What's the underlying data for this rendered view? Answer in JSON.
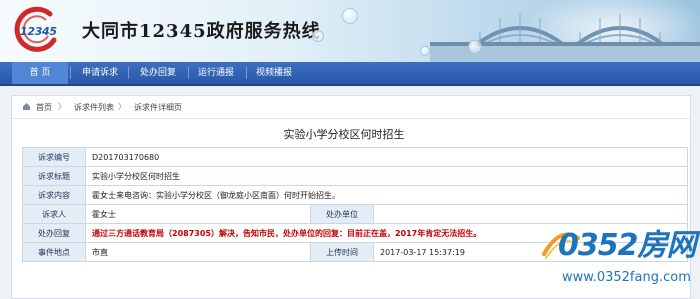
{
  "header": {
    "logo_text": "12345",
    "site_title": "大同市12345政府服务热线"
  },
  "nav": {
    "items": [
      {
        "label": "首 页",
        "active": true
      },
      {
        "label": "申请诉求",
        "active": false
      },
      {
        "label": "处办回复",
        "active": false
      },
      {
        "label": "运行通报",
        "active": false
      },
      {
        "label": "视频播报",
        "active": false
      }
    ]
  },
  "breadcrumb": {
    "home": "首页",
    "sep": "〉",
    "list": "诉求件列表",
    "current": "诉求件详细页"
  },
  "detail": {
    "title": "实验小学分校区何时招生",
    "rows": {
      "number_label": "诉求编号",
      "number_value": "D201703170680",
      "subject_label": "诉求标题",
      "subject_value": "实验小学分校区何时招生",
      "content_label": "诉求内容",
      "content_value": "霍女士来电咨询：实验小学分校区（御龙庭小区南面）何时开始招生。",
      "person_label": "诉求人",
      "person_value": "霍女士",
      "unit_label": "处办单位",
      "unit_value": "",
      "reply_label": "处办回复",
      "reply_value": "通过三方通话教育局（2087305）解决，告知市民，处办单位的回复：目前正在盖，2017年肯定无法招生。",
      "place_label": "事件地点",
      "place_value": "市直",
      "time_label": "上传时间",
      "time_value": "2017-03-17 15:37:19"
    }
  },
  "watermark": {
    "main": "0352房网",
    "sub": "www.0352fang.com"
  },
  "colors": {
    "nav": "#2a58a8",
    "nav_active": "#5185d6",
    "label_bg": "#e4ecf6",
    "alert_text": "#c40000",
    "watermark": "#1e73be"
  }
}
